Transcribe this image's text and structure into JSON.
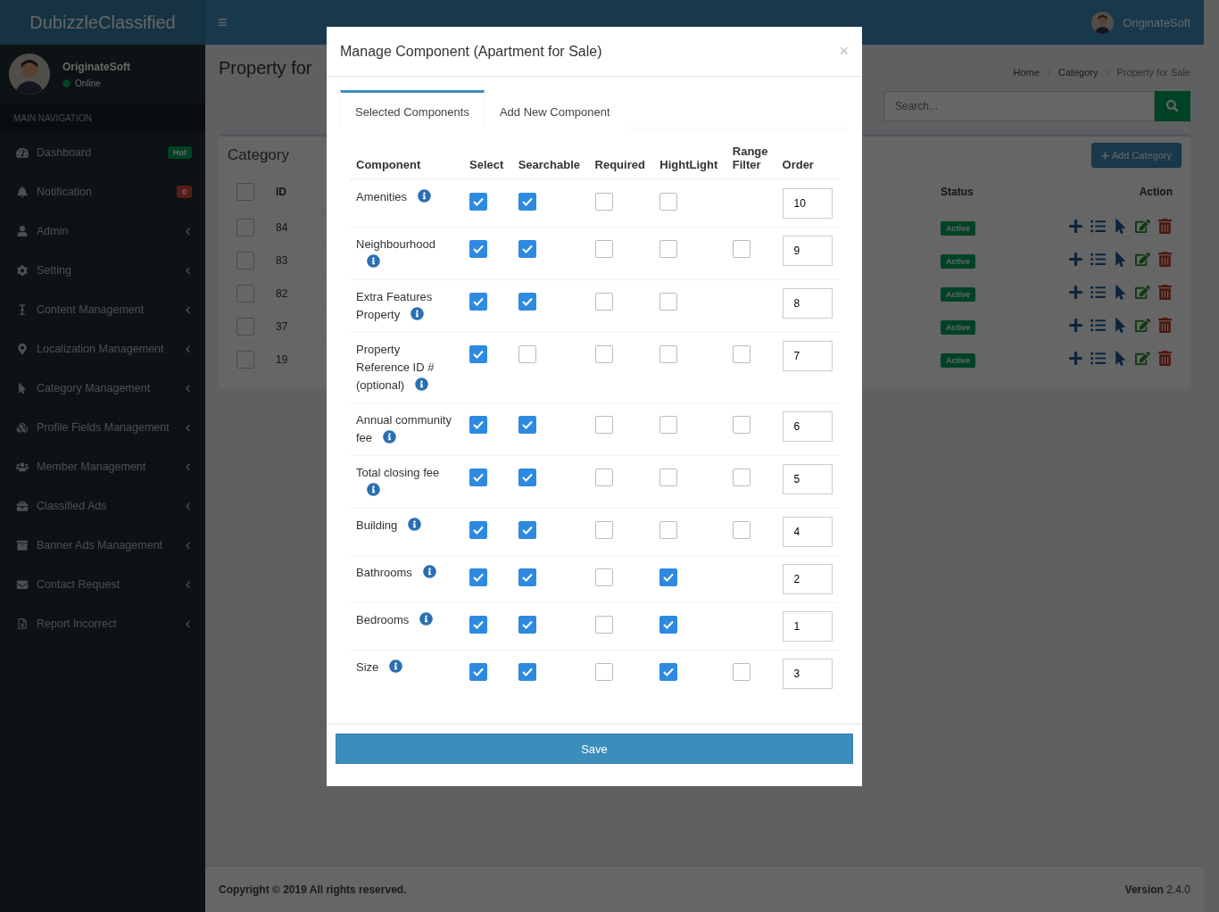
{
  "brand": "DubizzleClassified",
  "header": {
    "menu_glyph": "≡",
    "user": "OriginateSoft"
  },
  "sidebar": {
    "user": {
      "name": "OriginateSoft",
      "status": "Online"
    },
    "section": "MAIN NAVIGATION",
    "items": [
      {
        "label": "Dashboard",
        "expandable": false,
        "badge": {
          "text": "Hot",
          "kind": "success"
        }
      },
      {
        "label": "Notification",
        "expandable": false,
        "badge": {
          "text": "0",
          "kind": "danger"
        }
      },
      {
        "label": "Admin",
        "expandable": true
      },
      {
        "label": "Setting",
        "expandable": true
      },
      {
        "label": "Content Management",
        "expandable": true
      },
      {
        "label": "Localization Management",
        "expandable": true
      },
      {
        "label": "Category Management",
        "expandable": true
      },
      {
        "label": "Profile Fields Management",
        "expandable": true
      },
      {
        "label": "Member Management",
        "expandable": true
      },
      {
        "label": "Classified Ads",
        "expandable": true
      },
      {
        "label": "Banner Ads Management",
        "expandable": true
      },
      {
        "label": "Contact Request",
        "expandable": true
      },
      {
        "label": "Report Incorrect",
        "expandable": true
      }
    ]
  },
  "page": {
    "title": "Property for",
    "breadcrumb": [
      "Home",
      "Category",
      "Property for Sale"
    ],
    "search": {
      "placeholder": "Search..."
    }
  },
  "panel": {
    "title": "Category",
    "add_button": "Add Category",
    "select_all_checked": false,
    "columns": [
      "ID",
      "Status",
      "Action"
    ],
    "rows": [
      {
        "id": "84",
        "status": "Active",
        "checked": false
      },
      {
        "id": "83",
        "status": "Active",
        "checked": false
      },
      {
        "id": "82",
        "status": "Active",
        "checked": false
      },
      {
        "id": "37",
        "status": "Active",
        "checked": false
      },
      {
        "id": "19",
        "status": "Active",
        "checked": false
      }
    ]
  },
  "footer": {
    "copyright": "Copyright © 2019 All rights reserved.",
    "version_label": "Version",
    "version": "2.4.0"
  },
  "modal": {
    "title": "Manage Component (Apartment for Sale)",
    "close": "×",
    "tabs": [
      {
        "label": "Selected Components",
        "selected": true
      },
      {
        "label": "Add New Component",
        "selected": false
      }
    ],
    "columns": [
      "Component",
      "Select",
      "Searchable",
      "Required",
      "HightLight",
      "Range Filter",
      "Order"
    ],
    "rows": [
      {
        "name": "Amenities",
        "select": true,
        "searchable": true,
        "required": false,
        "highlight": false,
        "order": "10"
      },
      {
        "name": "Neighbourhood",
        "select": true,
        "searchable": true,
        "required": false,
        "highlight": false,
        "range_filter": false,
        "order": "9"
      },
      {
        "name": "Extra Features Property",
        "select": true,
        "searchable": true,
        "required": false,
        "highlight": false,
        "order": "8"
      },
      {
        "name": "Property Reference ID # (optional)",
        "select": true,
        "searchable": false,
        "required": false,
        "highlight": false,
        "range_filter": false,
        "order": "7"
      },
      {
        "name": "Annual community fee",
        "select": true,
        "searchable": true,
        "required": false,
        "highlight": false,
        "range_filter": false,
        "order": "6"
      },
      {
        "name": "Total closing fee",
        "select": true,
        "searchable": true,
        "required": false,
        "highlight": false,
        "range_filter": false,
        "order": "5"
      },
      {
        "name": "Building",
        "select": true,
        "searchable": true,
        "required": false,
        "highlight": false,
        "range_filter": false,
        "order": "4"
      },
      {
        "name": "Bathrooms",
        "select": true,
        "searchable": true,
        "required": false,
        "highlight": true,
        "order": "2"
      },
      {
        "name": "Bedrooms",
        "select": true,
        "searchable": true,
        "required": false,
        "highlight": true,
        "order": "1"
      },
      {
        "name": "Size",
        "select": true,
        "searchable": true,
        "required": false,
        "highlight": true,
        "range_filter": false,
        "order": "3"
      }
    ],
    "save": "Save"
  }
}
